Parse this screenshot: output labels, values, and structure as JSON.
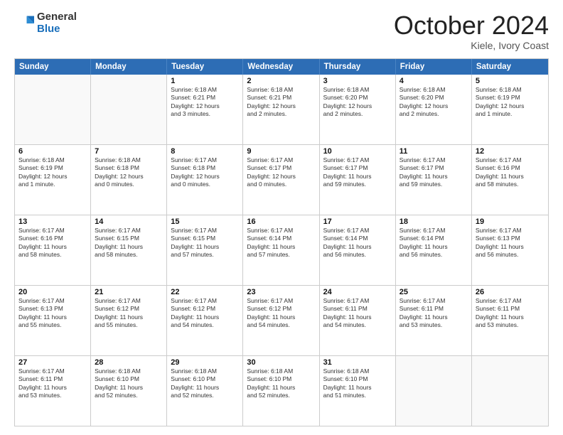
{
  "logo": {
    "general": "General",
    "blue": "Blue"
  },
  "header": {
    "month": "October 2024",
    "location": "Kiele, Ivory Coast"
  },
  "weekdays": [
    "Sunday",
    "Monday",
    "Tuesday",
    "Wednesday",
    "Thursday",
    "Friday",
    "Saturday"
  ],
  "rows": [
    [
      {
        "day": "",
        "info": ""
      },
      {
        "day": "",
        "info": ""
      },
      {
        "day": "1",
        "info": "Sunrise: 6:18 AM\nSunset: 6:21 PM\nDaylight: 12 hours\nand 3 minutes."
      },
      {
        "day": "2",
        "info": "Sunrise: 6:18 AM\nSunset: 6:21 PM\nDaylight: 12 hours\nand 2 minutes."
      },
      {
        "day": "3",
        "info": "Sunrise: 6:18 AM\nSunset: 6:20 PM\nDaylight: 12 hours\nand 2 minutes."
      },
      {
        "day": "4",
        "info": "Sunrise: 6:18 AM\nSunset: 6:20 PM\nDaylight: 12 hours\nand 2 minutes."
      },
      {
        "day": "5",
        "info": "Sunrise: 6:18 AM\nSunset: 6:19 PM\nDaylight: 12 hours\nand 1 minute."
      }
    ],
    [
      {
        "day": "6",
        "info": "Sunrise: 6:18 AM\nSunset: 6:19 PM\nDaylight: 12 hours\nand 1 minute."
      },
      {
        "day": "7",
        "info": "Sunrise: 6:18 AM\nSunset: 6:18 PM\nDaylight: 12 hours\nand 0 minutes."
      },
      {
        "day": "8",
        "info": "Sunrise: 6:17 AM\nSunset: 6:18 PM\nDaylight: 12 hours\nand 0 minutes."
      },
      {
        "day": "9",
        "info": "Sunrise: 6:17 AM\nSunset: 6:17 PM\nDaylight: 12 hours\nand 0 minutes."
      },
      {
        "day": "10",
        "info": "Sunrise: 6:17 AM\nSunset: 6:17 PM\nDaylight: 11 hours\nand 59 minutes."
      },
      {
        "day": "11",
        "info": "Sunrise: 6:17 AM\nSunset: 6:17 PM\nDaylight: 11 hours\nand 59 minutes."
      },
      {
        "day": "12",
        "info": "Sunrise: 6:17 AM\nSunset: 6:16 PM\nDaylight: 11 hours\nand 58 minutes."
      }
    ],
    [
      {
        "day": "13",
        "info": "Sunrise: 6:17 AM\nSunset: 6:16 PM\nDaylight: 11 hours\nand 58 minutes."
      },
      {
        "day": "14",
        "info": "Sunrise: 6:17 AM\nSunset: 6:15 PM\nDaylight: 11 hours\nand 58 minutes."
      },
      {
        "day": "15",
        "info": "Sunrise: 6:17 AM\nSunset: 6:15 PM\nDaylight: 11 hours\nand 57 minutes."
      },
      {
        "day": "16",
        "info": "Sunrise: 6:17 AM\nSunset: 6:14 PM\nDaylight: 11 hours\nand 57 minutes."
      },
      {
        "day": "17",
        "info": "Sunrise: 6:17 AM\nSunset: 6:14 PM\nDaylight: 11 hours\nand 56 minutes."
      },
      {
        "day": "18",
        "info": "Sunrise: 6:17 AM\nSunset: 6:14 PM\nDaylight: 11 hours\nand 56 minutes."
      },
      {
        "day": "19",
        "info": "Sunrise: 6:17 AM\nSunset: 6:13 PM\nDaylight: 11 hours\nand 56 minutes."
      }
    ],
    [
      {
        "day": "20",
        "info": "Sunrise: 6:17 AM\nSunset: 6:13 PM\nDaylight: 11 hours\nand 55 minutes."
      },
      {
        "day": "21",
        "info": "Sunrise: 6:17 AM\nSunset: 6:12 PM\nDaylight: 11 hours\nand 55 minutes."
      },
      {
        "day": "22",
        "info": "Sunrise: 6:17 AM\nSunset: 6:12 PM\nDaylight: 11 hours\nand 54 minutes."
      },
      {
        "day": "23",
        "info": "Sunrise: 6:17 AM\nSunset: 6:12 PM\nDaylight: 11 hours\nand 54 minutes."
      },
      {
        "day": "24",
        "info": "Sunrise: 6:17 AM\nSunset: 6:11 PM\nDaylight: 11 hours\nand 54 minutes."
      },
      {
        "day": "25",
        "info": "Sunrise: 6:17 AM\nSunset: 6:11 PM\nDaylight: 11 hours\nand 53 minutes."
      },
      {
        "day": "26",
        "info": "Sunrise: 6:17 AM\nSunset: 6:11 PM\nDaylight: 11 hours\nand 53 minutes."
      }
    ],
    [
      {
        "day": "27",
        "info": "Sunrise: 6:17 AM\nSunset: 6:11 PM\nDaylight: 11 hours\nand 53 minutes."
      },
      {
        "day": "28",
        "info": "Sunrise: 6:18 AM\nSunset: 6:10 PM\nDaylight: 11 hours\nand 52 minutes."
      },
      {
        "day": "29",
        "info": "Sunrise: 6:18 AM\nSunset: 6:10 PM\nDaylight: 11 hours\nand 52 minutes."
      },
      {
        "day": "30",
        "info": "Sunrise: 6:18 AM\nSunset: 6:10 PM\nDaylight: 11 hours\nand 52 minutes."
      },
      {
        "day": "31",
        "info": "Sunrise: 6:18 AM\nSunset: 6:10 PM\nDaylight: 11 hours\nand 51 minutes."
      },
      {
        "day": "",
        "info": ""
      },
      {
        "day": "",
        "info": ""
      }
    ]
  ]
}
